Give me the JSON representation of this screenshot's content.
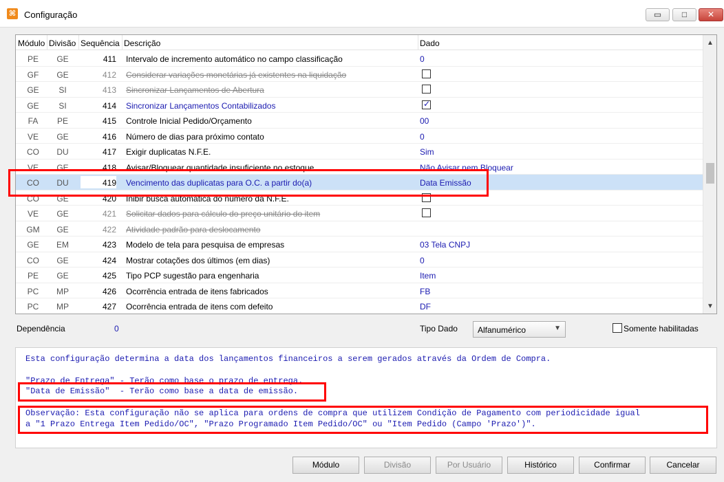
{
  "window": {
    "title": "Configuração",
    "app_icon": "app-logo-icon",
    "controls": {
      "minimize": "▭",
      "maximize": "□",
      "close": "✕"
    }
  },
  "grid": {
    "columns": {
      "modulo": "Módulo",
      "divisao": "Divisão",
      "sequencia": "Sequência",
      "descricao": "Descrição",
      "dado": "Dado"
    },
    "rows": [
      {
        "mod": "PE",
        "div": "GE",
        "seq": "411",
        "desc": "Intervalo de incremento automático no campo classificação",
        "value": "0",
        "kind": "text",
        "state": "normal"
      },
      {
        "mod": "GF",
        "div": "GE",
        "seq": "412",
        "desc": "Considerar variações monetárias já existentes na liquidação",
        "value": "",
        "kind": "checkbox",
        "checked": false,
        "state": "disabled"
      },
      {
        "mod": "GE",
        "div": "SI",
        "seq": "413",
        "desc": "Sincronizar Lançamentos de Abertura",
        "value": "",
        "kind": "checkbox",
        "checked": false,
        "state": "disabled"
      },
      {
        "mod": "GE",
        "div": "SI",
        "seq": "414",
        "desc": "Sincronizar Lançamentos Contabilizados",
        "value": "",
        "kind": "checkbox",
        "checked": true,
        "state": "highlight"
      },
      {
        "mod": "FA",
        "div": "PE",
        "seq": "415",
        "desc": "Controle Inicial Pedido/Orçamento",
        "value": "00",
        "kind": "text",
        "state": "normal"
      },
      {
        "mod": "VE",
        "div": "GE",
        "seq": "416",
        "desc": "Número de dias para próximo contato",
        "value": "0",
        "kind": "text",
        "state": "normal"
      },
      {
        "mod": "CO",
        "div": "DU",
        "seq": "417",
        "desc": "Exigir duplicatas N.F.E.",
        "value": "Sim",
        "kind": "text",
        "state": "normal"
      },
      {
        "mod": "VE",
        "div": "GE",
        "seq": "418",
        "desc": "Avisar/Bloquear quantidade insuficiente no estoque",
        "value": "Não Avisar nem Bloquear",
        "kind": "text",
        "state": "normal"
      },
      {
        "mod": "CO",
        "div": "DU",
        "seq": "419",
        "desc": "Vencimento das duplicatas para O.C. a partir do(a)",
        "value": "Data Emissão",
        "kind": "text",
        "state": "selected"
      },
      {
        "mod": "CO",
        "div": "GE",
        "seq": "420",
        "desc": "Inibir busca automática do número da N.F.E.",
        "value": "",
        "kind": "checkbox",
        "checked": false,
        "state": "normal"
      },
      {
        "mod": "VE",
        "div": "GE",
        "seq": "421",
        "desc": "Solicitar dados para cálculo do preço unitário do item",
        "value": "",
        "kind": "checkbox",
        "checked": false,
        "state": "disabled"
      },
      {
        "mod": "GM",
        "div": "GE",
        "seq": "422",
        "desc": "Atividade padrão para deslocamento",
        "value": "",
        "kind": "text",
        "state": "disabled"
      },
      {
        "mod": "GE",
        "div": "EM",
        "seq": "423",
        "desc": "Modelo de tela para pesquisa de empresas",
        "value": "03 Tela CNPJ",
        "kind": "text",
        "state": "normal"
      },
      {
        "mod": "CO",
        "div": "GE",
        "seq": "424",
        "desc": "Mostrar cotações dos últimos (em dias)",
        "value": "0",
        "kind": "text",
        "state": "normal"
      },
      {
        "mod": "PE",
        "div": "GE",
        "seq": "425",
        "desc": "Tipo PCP sugestão para engenharia",
        "value": "Item",
        "kind": "text",
        "state": "normal"
      },
      {
        "mod": "PC",
        "div": "MP",
        "seq": "426",
        "desc": "Ocorrência entrada de itens fabricados",
        "value": "FB",
        "kind": "text",
        "state": "normal"
      },
      {
        "mod": "PC",
        "div": "MP",
        "seq": "427",
        "desc": "Ocorrência entrada de itens com defeito",
        "value": "DF",
        "kind": "text",
        "state": "normal"
      }
    ]
  },
  "properties": {
    "dependencia_label": "Dependência",
    "dependencia_value": "0",
    "tipo_dado_label": "Tipo Dado",
    "tipo_dado_value": "Alfanumérico",
    "somente_label": "Somente habilitadas"
  },
  "info": {
    "line1": "Esta configuração determina a data dos lançamentos financeiros a serem gerados através da Ordem de Compra.",
    "line2": "\"Prazo de Entrega\" - Terão como base o prazo de entrega.",
    "line3": "\"Data de Emissão\"  - Terão como base a data de emissão.",
    "line4": "Observação: Esta configuração não se aplica para ordens de compra que utilizem Condição de Pagamento com periodicidade igual",
    "line5": "a \"1 Prazo Entrega Item Pedido/OC\", \"Prazo Programado Item Pedido/OC\" ou \"Item Pedido (Campo 'Prazo')\"."
  },
  "buttons": {
    "modulo": "Módulo",
    "divisao": "Divisão",
    "por_usuario": "Por Usuário",
    "historico": "Histórico",
    "confirmar": "Confirmar",
    "cancelar": "Cancelar"
  },
  "colors": {
    "value_blue": "#1a1ab0",
    "selection": "#cce1f7",
    "annotation_red": "#ff0000"
  }
}
